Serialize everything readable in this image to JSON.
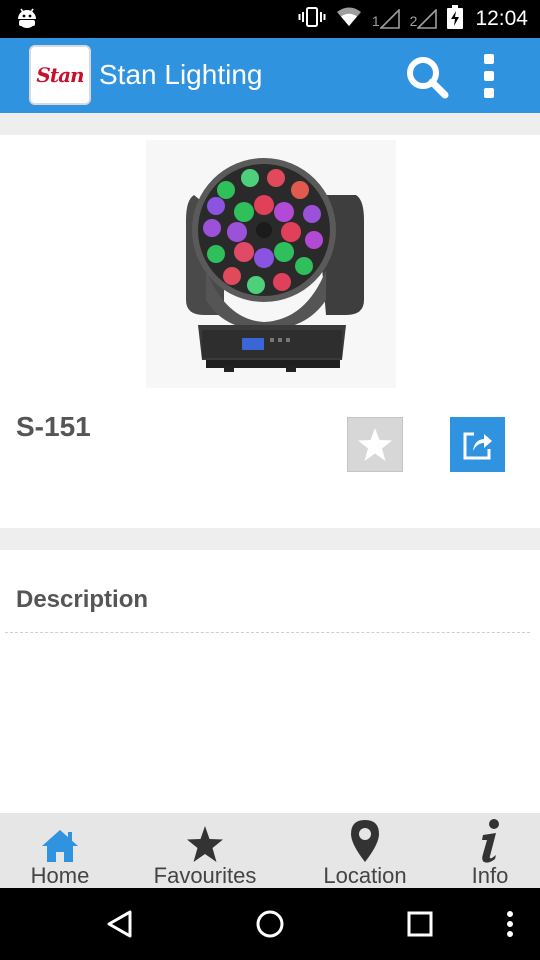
{
  "status_bar": {
    "sim1_label": "1",
    "sim2_label": "2",
    "time": "12:04"
  },
  "app_bar": {
    "logo_text": "Stan",
    "title": "Stan Lighting"
  },
  "product": {
    "name": "S-151",
    "image_alt": "moving head LED light"
  },
  "description": {
    "heading": "Description"
  },
  "tabs": [
    {
      "label": "Home",
      "icon": "home-icon",
      "active": true
    },
    {
      "label": "Favourites",
      "icon": "star-icon",
      "active": false
    },
    {
      "label": "Location",
      "icon": "location-pin-icon",
      "active": false
    },
    {
      "label": "Info",
      "icon": "info-icon",
      "active": false
    }
  ],
  "colors": {
    "accent": "#2f93e0",
    "active_tab": "#2f93e0",
    "inactive_tab": "#333333",
    "text": "#555555"
  }
}
